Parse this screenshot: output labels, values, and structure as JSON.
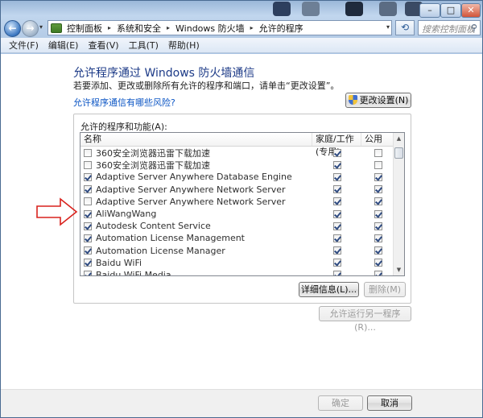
{
  "titlebar": {
    "minimize": "–",
    "maximize": "□",
    "close": "✕"
  },
  "nav": {
    "back_icon": "←",
    "forward_icon": "→",
    "dropdown_icon": "▾",
    "refresh_icon": "⟲"
  },
  "address": {
    "crumbs": [
      "控制面板",
      "系统和安全",
      "Windows 防火墙",
      "允许的程序"
    ]
  },
  "search": {
    "placeholder": "搜索控制面板",
    "icon": "search-icon"
  },
  "menu": {
    "items": [
      "文件(F)",
      "编辑(E)",
      "查看(V)",
      "工具(T)",
      "帮助(H)"
    ]
  },
  "main": {
    "heading": "允许程序通过 Windows 防火墙通信",
    "subtitle": "若要添加、更改或删除所有允许的程序和端口，请单击“更改设置”。",
    "risk_link": "允许程序通信有哪些风险?",
    "change_settings": "更改设置(N)",
    "group_label": "允许的程序和功能(A):",
    "columns": {
      "name": "名称",
      "home": "家庭/工作(专用)",
      "public": "公用"
    },
    "rows": [
      {
        "name": "360安全浏览器迅雷下载加速",
        "enabled": false,
        "home": true,
        "public": false
      },
      {
        "name": "360安全浏览器迅雷下载加速",
        "enabled": false,
        "home": true,
        "public": false
      },
      {
        "name": "Adaptive Server Anywhere Database Engine",
        "enabled": true,
        "home": true,
        "public": true
      },
      {
        "name": "Adaptive Server Anywhere Network Server",
        "enabled": true,
        "home": true,
        "public": true
      },
      {
        "name": "Adaptive Server Anywhere Network Server",
        "enabled": false,
        "home": true,
        "public": true
      },
      {
        "name": "AliWangWang",
        "enabled": true,
        "home": true,
        "public": true
      },
      {
        "name": "Autodesk Content Service",
        "enabled": true,
        "home": true,
        "public": true
      },
      {
        "name": "Automation License Management",
        "enabled": true,
        "home": true,
        "public": true
      },
      {
        "name": "Automation License Manager",
        "enabled": true,
        "home": true,
        "public": true
      },
      {
        "name": "Baidu WiFi",
        "enabled": true,
        "home": true,
        "public": true
      },
      {
        "name": "Baidu WiFi Media",
        "enabled": true,
        "home": true,
        "public": true
      }
    ],
    "details_button": "详细信息(L)...",
    "remove_button": "删除(M)",
    "allow_other_button": "允许运行另一程序(R)..."
  },
  "footer": {
    "ok": "确定",
    "cancel": "取消"
  },
  "colors": {
    "heading": "#1c3a87",
    "link": "#0b55c4",
    "arrow": "#d9221d"
  }
}
